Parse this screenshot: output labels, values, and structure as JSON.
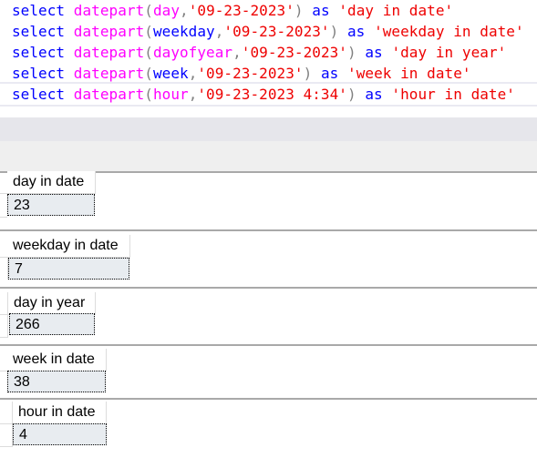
{
  "editor": {
    "lines": [
      {
        "kw": "select",
        "fn": "datepart",
        "arg": "day",
        "date": "'09-23-2023'",
        "as": "as",
        "alias": "'day in date'"
      },
      {
        "kw": "select",
        "fn": "datepart",
        "arg": "weekday",
        "date": "'09-23-2023'",
        "as": "as",
        "alias": "'weekday in date'"
      },
      {
        "kw": "select",
        "fn": "datepart",
        "arg": "dayofyear",
        "date": "'09-23-2023'",
        "as": "as",
        "alias": "'day in year'"
      },
      {
        "kw": "select",
        "fn": "datepart",
        "arg": "week",
        "date": "'09-23-2023'",
        "as": "as",
        "alias": "'week in date'"
      },
      {
        "kw": "select",
        "fn": "datepart",
        "arg": "hour",
        "date": "'09-23-2023 4:34'",
        "as": "as",
        "alias": "'hour in date'"
      }
    ]
  },
  "results": [
    {
      "column": "day in date",
      "value": "23"
    },
    {
      "column": "weekday in date",
      "value": "7"
    },
    {
      "column": "day in year",
      "value": "266"
    },
    {
      "column": "week in date",
      "value": "38"
    },
    {
      "column": "hour in date",
      "value": "4"
    }
  ]
}
